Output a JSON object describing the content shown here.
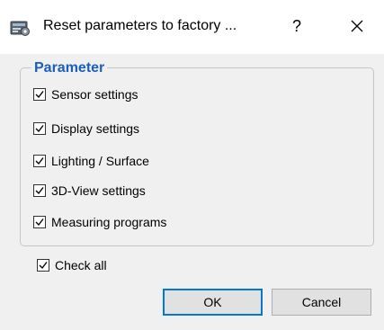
{
  "window": {
    "title": "Reset parameters to factory ...",
    "help_label": "?",
    "close_icon": "close-icon",
    "app_icon": "settings-window-icon"
  },
  "group": {
    "legend": "Parameter",
    "legend_color": "#1a5ebf",
    "items": [
      {
        "label": "Sensor settings",
        "checked": true
      },
      {
        "label": "Display settings",
        "checked": true
      },
      {
        "label": "Lighting / Surface",
        "checked": true
      },
      {
        "label": "3D-View settings",
        "checked": true
      },
      {
        "label": "Measuring programs",
        "checked": true
      }
    ]
  },
  "check_all": {
    "label": "Check all",
    "checked": true
  },
  "buttons": {
    "ok_label": "OK",
    "cancel_label": "Cancel",
    "focus_color": "#0078d7"
  }
}
